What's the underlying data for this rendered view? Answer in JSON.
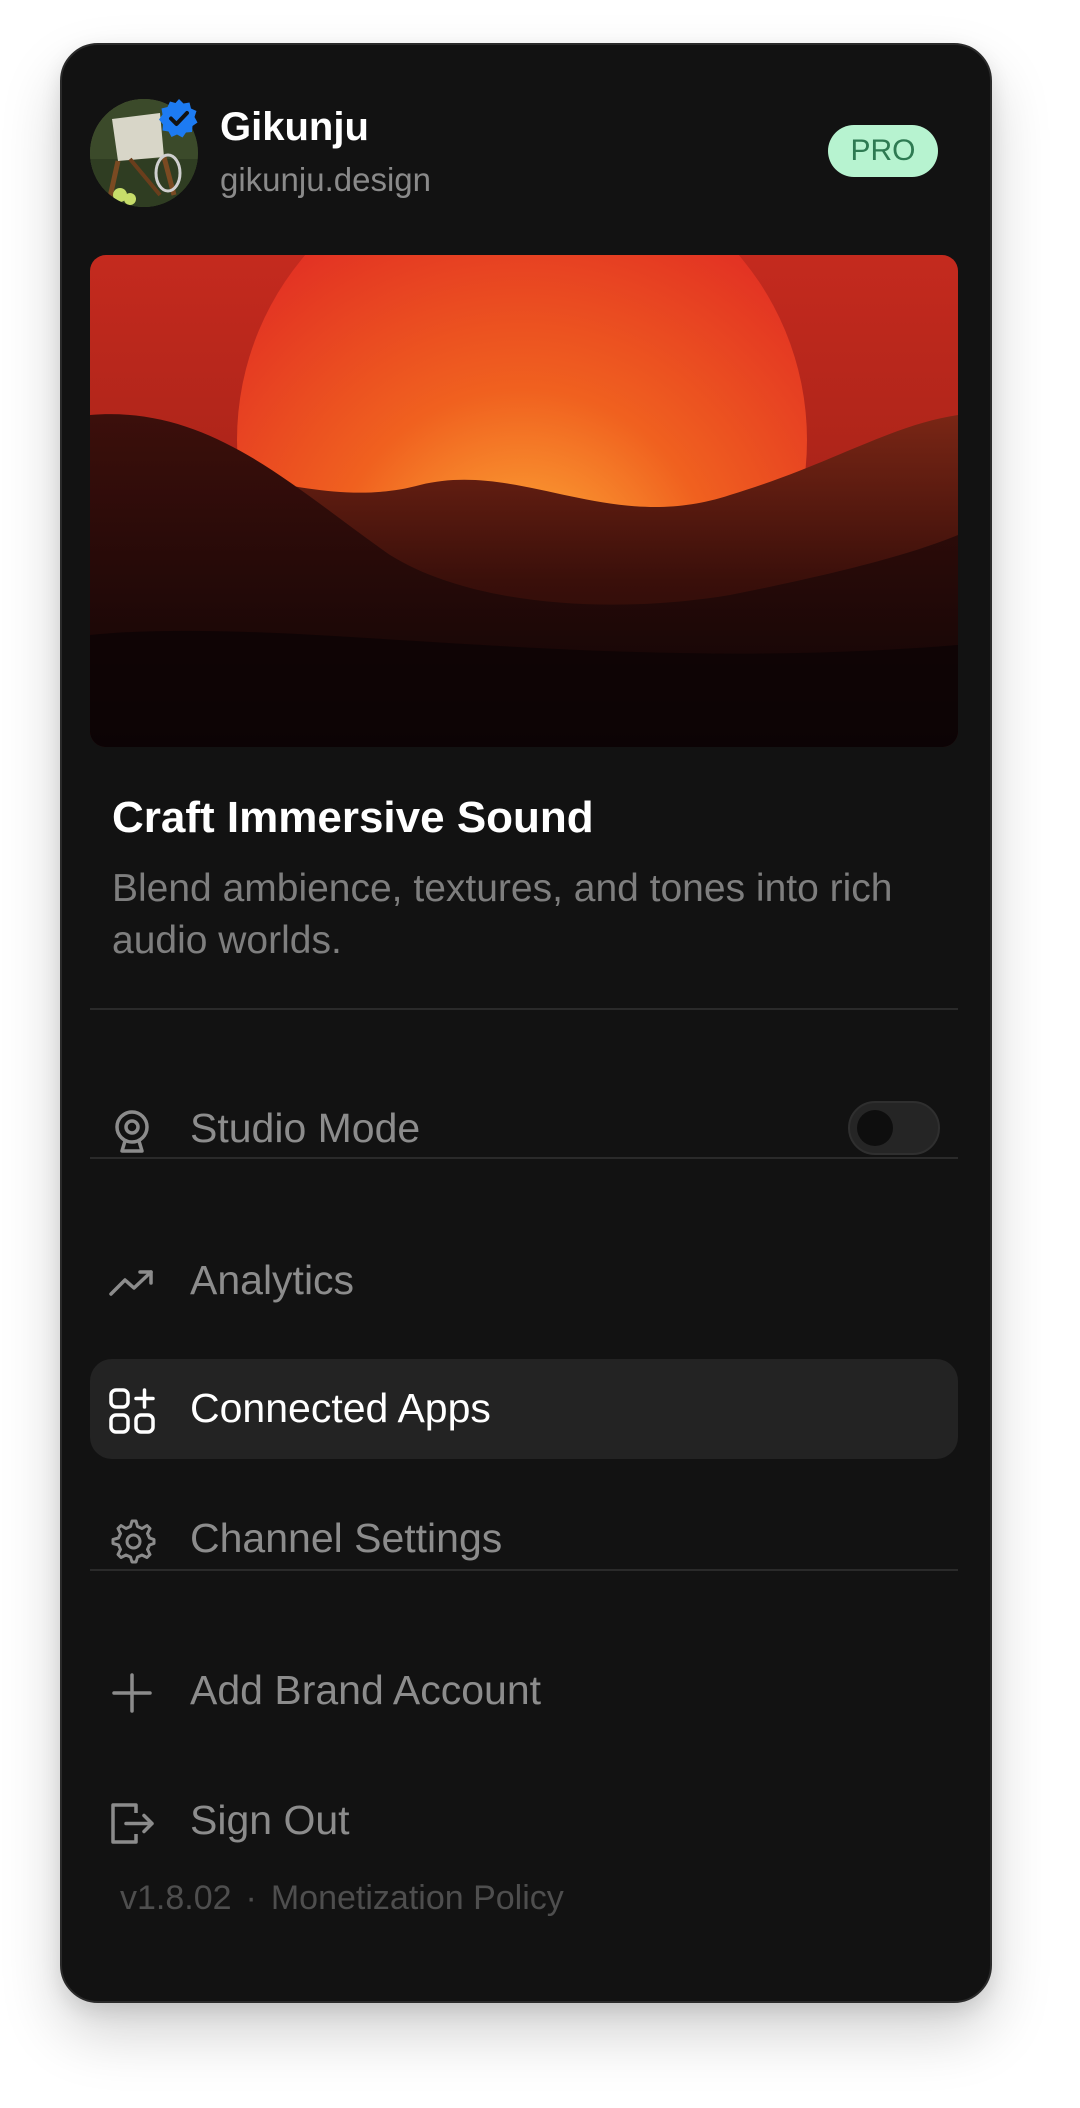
{
  "profile": {
    "name": "Gikunju",
    "handle": "gikunju.design",
    "badge": "PRO",
    "avatar_icon": "avatar-image",
    "verified_icon": "verified-check-icon"
  },
  "hero": {
    "title": "Craft Immersive Sound",
    "description": "Blend ambience, textures, and tones into rich audio worlds."
  },
  "menu": {
    "studio_mode": {
      "label": "Studio Mode",
      "icon": "webcam-icon",
      "toggle_on": false
    },
    "analytics": {
      "label": "Analytics",
      "icon": "trending-up-icon"
    },
    "connected_apps": {
      "label": "Connected Apps",
      "icon": "apps-add-icon",
      "active": true
    },
    "channel_settings": {
      "label": "Channel Settings",
      "icon": "gear-icon"
    },
    "add_brand_account": {
      "label": "Add Brand Account",
      "icon": "plus-icon"
    },
    "sign_out": {
      "label": "Sign Out",
      "icon": "sign-out-icon"
    }
  },
  "footer": {
    "version": "v1.8.02",
    "separator": "·",
    "policy_link": "Monetization Policy"
  },
  "colors": {
    "card_bg": "#121212",
    "active_bg": "#232323",
    "badge_bg": "#b7f3d0",
    "badge_text": "#2e7a52",
    "verified": "#1d7bf2"
  }
}
